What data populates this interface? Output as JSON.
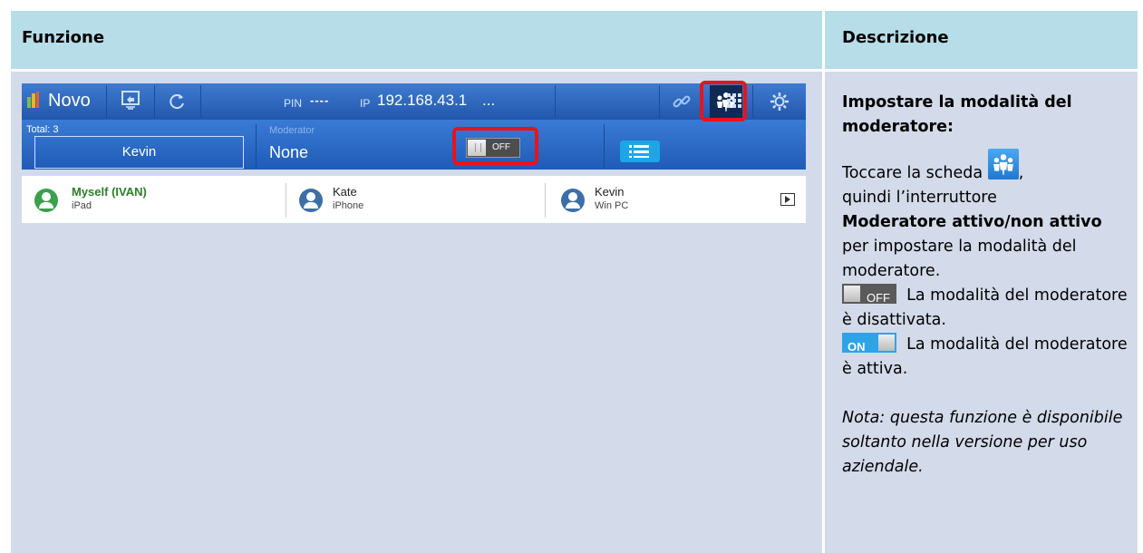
{
  "table": {
    "header_function": "Funzione",
    "header_description": "Descrizione"
  },
  "app": {
    "logo_text": "Novo",
    "pin_label": "PIN",
    "pin_value": "----",
    "ip_label": "IP",
    "ip_value": "192.168.43.1",
    "ip_more": "...",
    "total_label": "Total: 3",
    "presenter_name": "Kevin",
    "moderator_label": "Moderator",
    "moderator_value": "None",
    "toggle_label": "OFF",
    "participants": [
      {
        "name": "Myself (IVAN)",
        "device": "iPad",
        "avatar_color": "#3aa14a",
        "name_color": "#2a7f2a"
      },
      {
        "name": "Kate",
        "device": "iPhone",
        "avatar_color": "#3b6fa8",
        "name_color": "#222222"
      },
      {
        "name": "Kevin",
        "device": "Win PC",
        "avatar_color": "#3b6fa8",
        "name_color": "#222222"
      }
    ],
    "icons": [
      "screen-share-icon",
      "refresh-icon",
      "link-icon",
      "users-icon",
      "grid-icon",
      "settings-icon",
      "list-icon",
      "present-icon"
    ],
    "highlight_color": "#e8131b"
  },
  "description": {
    "title": "Impostare la modalità del moderatore:",
    "tap_prefix": "Toccare la scheda",
    "tap_suffix": ",",
    "then_text": "quindi l’interruttore",
    "switch_name": "Moderatore attivo/non attivo",
    "purpose_text": "per impostare la modalità del moderatore.",
    "off_label": "OFF",
    "off_text": "La modalità del moderatore è disattivata.",
    "on_label": "ON",
    "on_text": "La modalità del moderatore è attiva.",
    "note": "Nota: questa funzione è disponibile soltanto nella versione per uso aziendale."
  }
}
